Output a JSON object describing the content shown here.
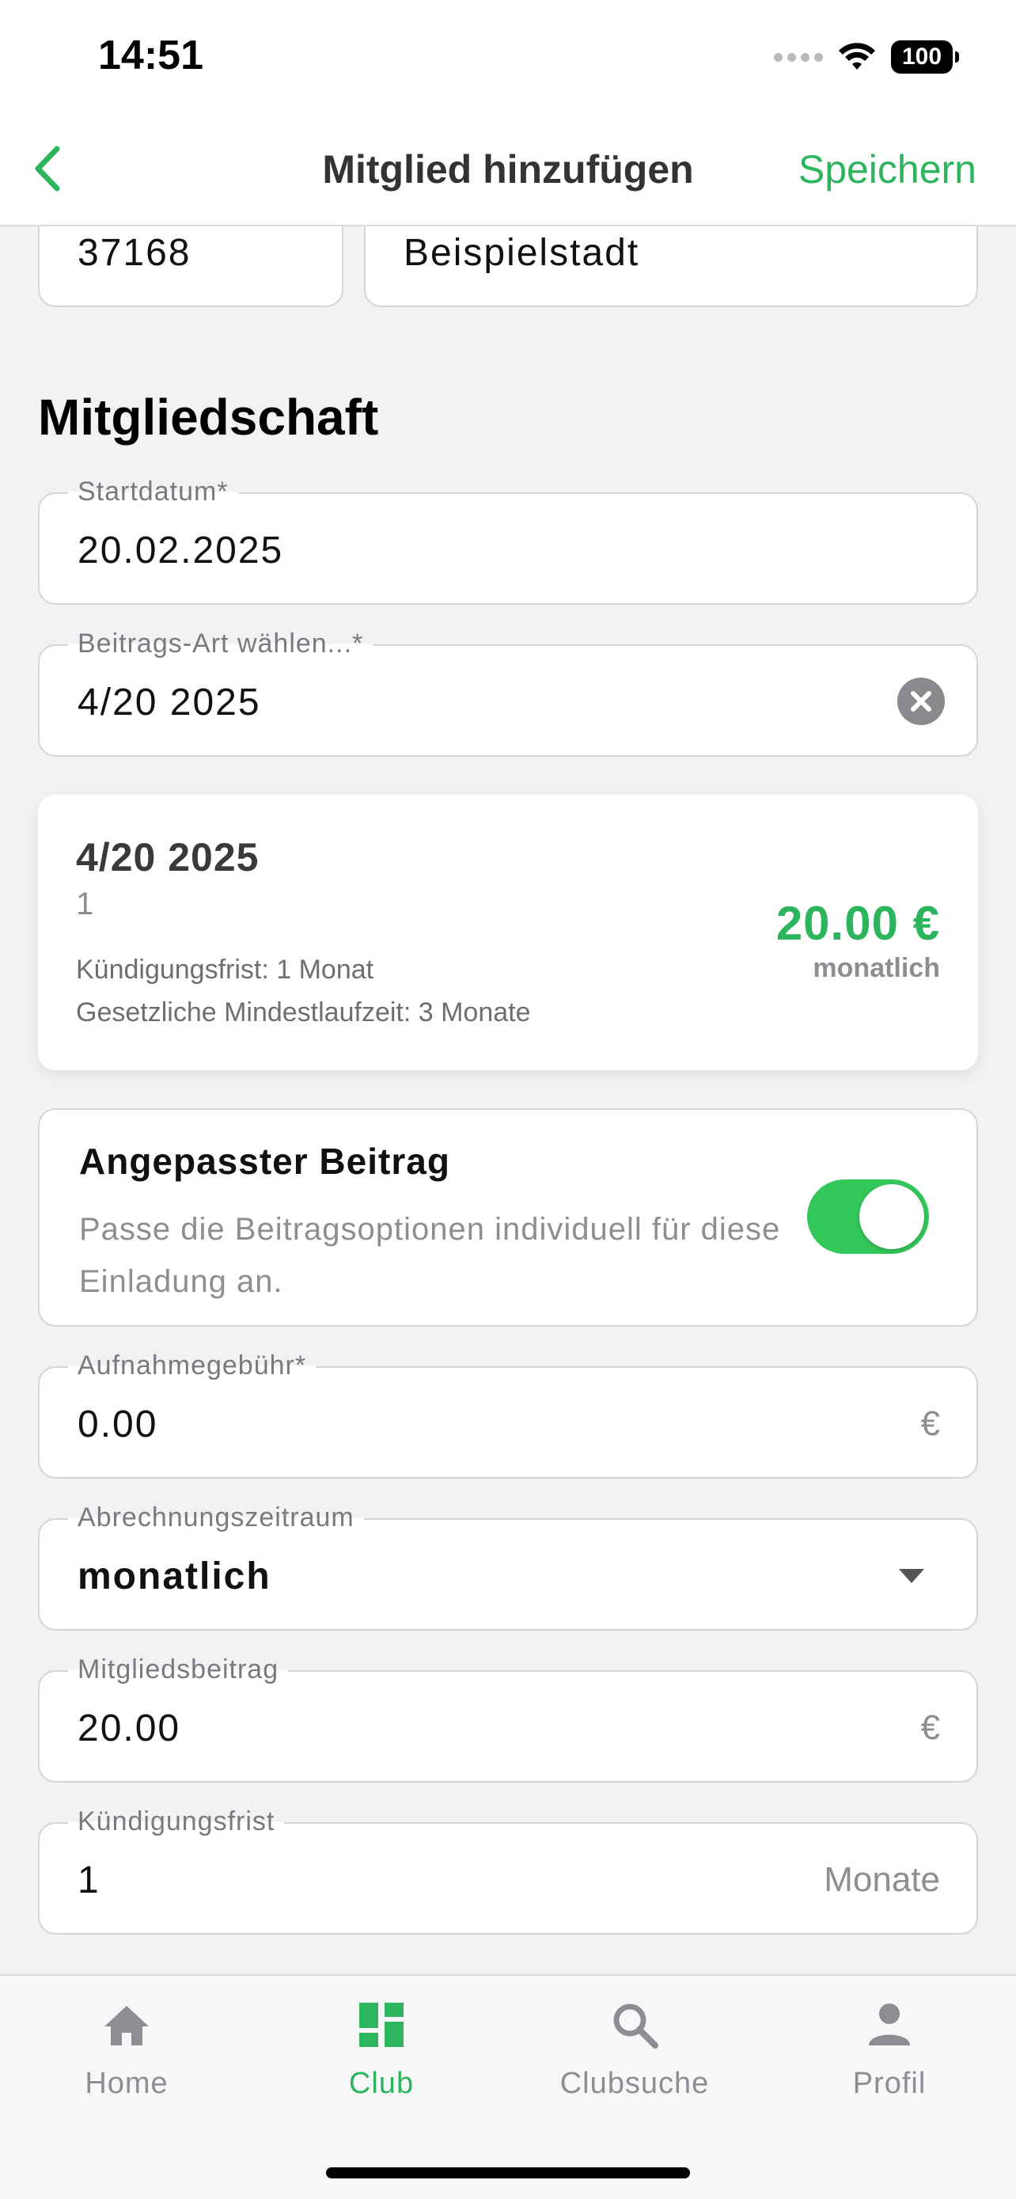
{
  "status": {
    "time": "14:51",
    "battery": "100"
  },
  "nav": {
    "title": "Mitglied hinzufügen",
    "save_label": "Speichern"
  },
  "address": {
    "zip": "37168",
    "city": "Beispielstadt"
  },
  "membership": {
    "section_title": "Mitgliedschaft",
    "start_date": {
      "label": "Startdatum*",
      "value": "20.02.2025"
    },
    "fee_type": {
      "label": "Beitrags-Art wählen...*",
      "value": "4/20 2025"
    }
  },
  "fee_card": {
    "title": "4/20 2025",
    "subtitle": "1",
    "notice_period": "Kündigungsfrist: 1 Monat",
    "min_term": "Gesetzliche Mindestlaufzeit: 3 Monate",
    "price": "20.00 €",
    "period": "monatlich"
  },
  "custom_fee": {
    "title": "Angepasster Beitrag",
    "description": "Passe die Beitragsoptionen individuell für diese Einladung an.",
    "enabled": true
  },
  "fields": {
    "admission_fee": {
      "label": "Aufnahmegebühr*",
      "value": "0.00",
      "suffix": "€"
    },
    "billing_period": {
      "label": "Abrechnungszeitraum",
      "value": "monatlich"
    },
    "member_fee": {
      "label": "Mitgliedsbeitrag",
      "value": "20.00",
      "suffix": "€"
    },
    "notice_period": {
      "label": "Kündigungsfrist",
      "value": "1",
      "suffix": "Monate"
    }
  },
  "tabs": [
    {
      "label": "Home",
      "icon": "home-icon",
      "active": false
    },
    {
      "label": "Club",
      "icon": "dashboard-icon",
      "active": true
    },
    {
      "label": "Clubsuche",
      "icon": "search-icon",
      "active": false
    },
    {
      "label": "Profil",
      "icon": "person-icon",
      "active": false
    }
  ],
  "colors": {
    "accent": "#2db55d",
    "toggle_on": "#34c759"
  }
}
